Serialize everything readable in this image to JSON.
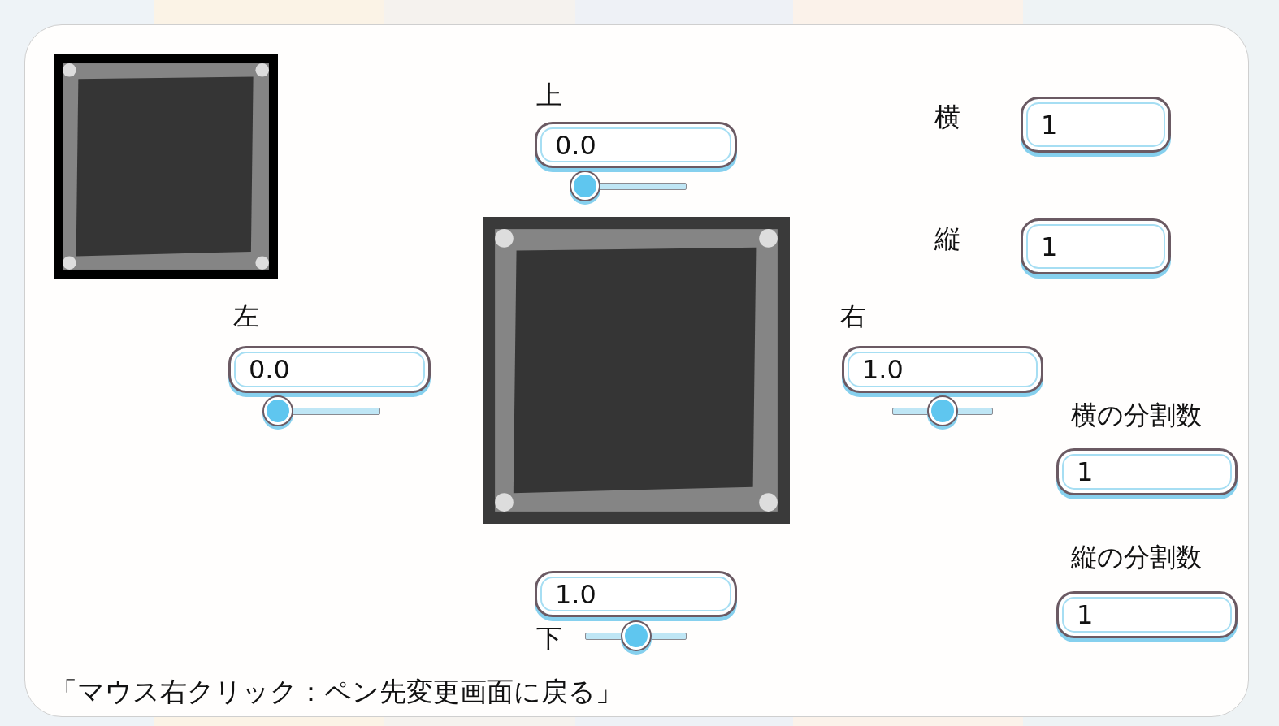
{
  "margins": [
    {
      "kind": "top",
      "label": "上",
      "value": "0.0",
      "level": 0
    },
    {
      "kind": "left",
      "label": "左",
      "value": "0.0",
      "level": 0
    },
    {
      "kind": "right",
      "label": "右",
      "value": "1.0",
      "level": 0.5
    },
    {
      "kind": "bottom",
      "label": "下",
      "value": "1.0",
      "level": 0.5
    }
  ],
  "grid": [
    {
      "kind": "columns",
      "label": "横",
      "value": "1"
    },
    {
      "kind": "rows",
      "label": "縦",
      "value": "1"
    }
  ],
  "divisions": [
    {
      "kind": "columns",
      "label": "横の分割数",
      "value": "1"
    },
    {
      "kind": "rows",
      "label": "縦の分割数",
      "value": "1"
    }
  ],
  "hint": "「マウス右クリック：ペン先変更画面に戻る」"
}
